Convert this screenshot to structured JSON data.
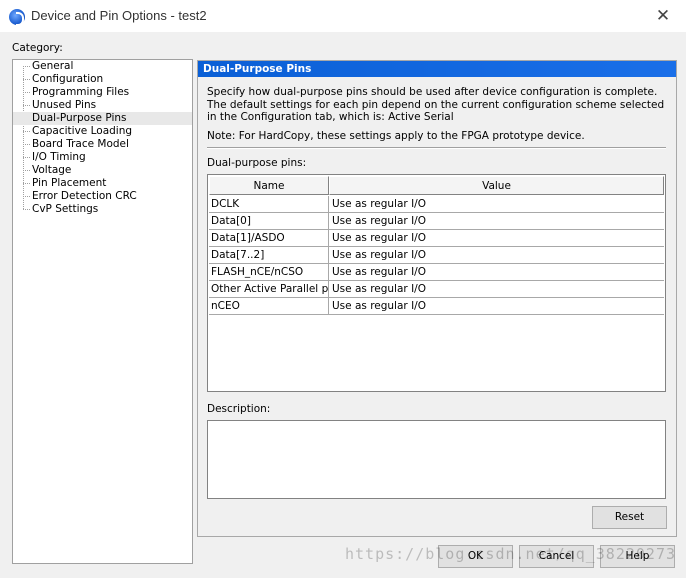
{
  "window": {
    "title": "Device and Pin Options - test2",
    "close_glyph": "✕"
  },
  "category": {
    "label": "Category:",
    "items": [
      {
        "label": "General"
      },
      {
        "label": "Configuration"
      },
      {
        "label": "Programming Files"
      },
      {
        "label": "Unused Pins"
      },
      {
        "label": "Dual-Purpose Pins",
        "selected": true
      },
      {
        "label": "Capacitive Loading"
      },
      {
        "label": "Board Trace Model"
      },
      {
        "label": "I/O Timing"
      },
      {
        "label": "Voltage"
      },
      {
        "label": "Pin Placement"
      },
      {
        "label": "Error Detection CRC"
      },
      {
        "label": "CvP Settings"
      }
    ]
  },
  "panel": {
    "title": "Dual-Purpose Pins",
    "description": "Specify how dual-purpose pins should be used after device configuration is complete. The default settings for each pin depend on the current configuration scheme selected in the Configuration tab, which is:  Active Serial",
    "note": "Note: For HardCopy, these settings apply to the FPGA prototype device.",
    "pins_label": "Dual-purpose pins:",
    "table": {
      "columns": [
        "Name",
        "Value"
      ],
      "rows": [
        {
          "name": "DCLK",
          "value": "Use as regular I/O"
        },
        {
          "name": "Data[0]",
          "value": "Use as regular I/O"
        },
        {
          "name": "Data[1]/ASDO",
          "value": "Use as regular I/O"
        },
        {
          "name": "Data[7..2]",
          "value": "Use as regular I/O"
        },
        {
          "name": "FLASH_nCE/nCSO",
          "value": "Use as regular I/O"
        },
        {
          "name": "Other Active Parallel pins",
          "value": "Use as regular I/O"
        },
        {
          "name": "nCEO",
          "value": "Use as regular I/O"
        }
      ]
    },
    "description_label": "Description:",
    "description_value": "",
    "reset_label": "Reset"
  },
  "footer": {
    "ok_label": "OK",
    "cancel_label": "Cancel",
    "help_label": "Help"
  },
  "watermark": "https://blog.csdn.net/qq_38220273",
  "colors": {
    "header_blue": "#0a5fd6",
    "dialog_bg": "#f0f0f0"
  }
}
